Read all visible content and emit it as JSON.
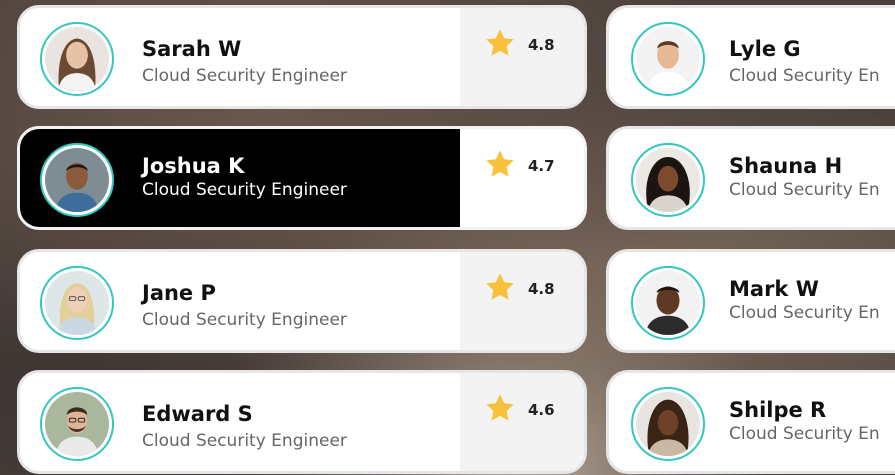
{
  "cards": [
    {
      "name": "Sarah W",
      "title": "Cloud Security Engineer",
      "rating": "4.8",
      "selected": false
    },
    {
      "name": "Joshua K",
      "title": "Cloud Security Engineer",
      "rating": "4.7",
      "selected": true
    },
    {
      "name": "Jane P",
      "title": "Cloud Security Engineer",
      "rating": "4.8",
      "selected": false
    },
    {
      "name": "Edward S",
      "title": "Cloud Security Engineer",
      "rating": "4.6",
      "selected": false
    },
    {
      "name": "Lyle G",
      "title": "Cloud Security En"
    },
    {
      "name": "Shauna H",
      "title": "Cloud Security En"
    },
    {
      "name": "Mark W",
      "title": "Cloud Security En"
    },
    {
      "name": "Shilpe R",
      "title": "Cloud Security En"
    }
  ],
  "colors": {
    "avatar_ring": "#33c7bf",
    "star": "#f8c13b",
    "selected_bg": "#000000",
    "card_bg": "#ffffff"
  },
  "icons": {
    "rating": "star-icon",
    "profile": "avatar-photo"
  }
}
